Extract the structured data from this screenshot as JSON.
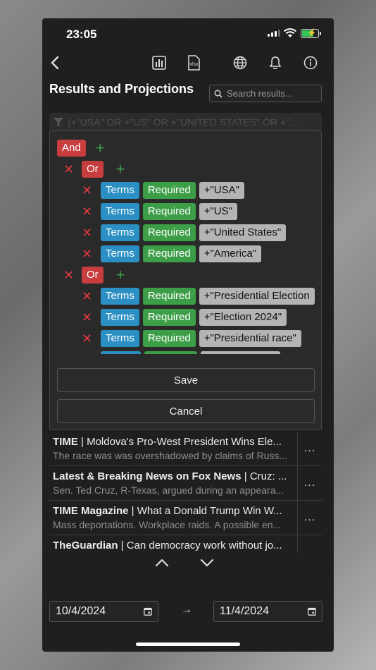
{
  "status": {
    "time": "23:05"
  },
  "toolbar": {
    "icons": [
      "back-icon",
      "bar-chart-icon",
      "xlsx-export-icon",
      "globe-icon",
      "bell-icon",
      "info-icon"
    ],
    "xlsx_label": "xlsx"
  },
  "page": {
    "title": "Results and Projections"
  },
  "search": {
    "placeholder": "Search results..."
  },
  "filter": {
    "query": "(+\"USA\" OR +\"US\" OR +\"UNITED STATES\" OR +\"..."
  },
  "builder": {
    "root_op": "And",
    "groups": [
      {
        "op": "Or",
        "terms": [
          {
            "type": "Terms",
            "mode": "Required",
            "value": "+\"USA\""
          },
          {
            "type": "Terms",
            "mode": "Required",
            "value": "+\"US\""
          },
          {
            "type": "Terms",
            "mode": "Required",
            "value": "+\"United States\""
          },
          {
            "type": "Terms",
            "mode": "Required",
            "value": "+\"America\""
          }
        ]
      },
      {
        "op": "Or",
        "terms": [
          {
            "type": "Terms",
            "mode": "Required",
            "value": "+\"Presidential Election"
          },
          {
            "type": "Terms",
            "mode": "Required",
            "value": "+\"Election 2024\""
          },
          {
            "type": "Terms",
            "mode": "Required",
            "value": "+\"Presidential race\""
          }
        ]
      }
    ],
    "save_label": "Save",
    "cancel_label": "Cancel"
  },
  "results": [
    {
      "source": "TIME",
      "headline": "Moldova's Pro-West President Wins Ele...",
      "snippet": "The race was was overshadowed by claims of Russ..."
    },
    {
      "source": "Latest & Breaking News on Fox News",
      "headline": "Cruz: ...",
      "snippet": "Sen. Ted Cruz, R-Texas, argued during an appeara..."
    },
    {
      "source": "TIME Magazine",
      "headline": "What a Donald Trump Win W...",
      "snippet": "Mass deportations. Workplace raids. A possible en..."
    },
    {
      "source": "TheGuardian",
      "headline": "Can democracy work without jo...",
      "snippet": ""
    }
  ],
  "more_label": "...",
  "dates": {
    "from": "10/4/2024",
    "to": "11/4/2024",
    "arrow": "→"
  },
  "colors": {
    "and_or": "#c83d3d",
    "terms": "#2b8fc3",
    "required": "#3d9e48",
    "remove": "#e0393e",
    "add": "#3aa04a",
    "battery": "#34c759"
  }
}
